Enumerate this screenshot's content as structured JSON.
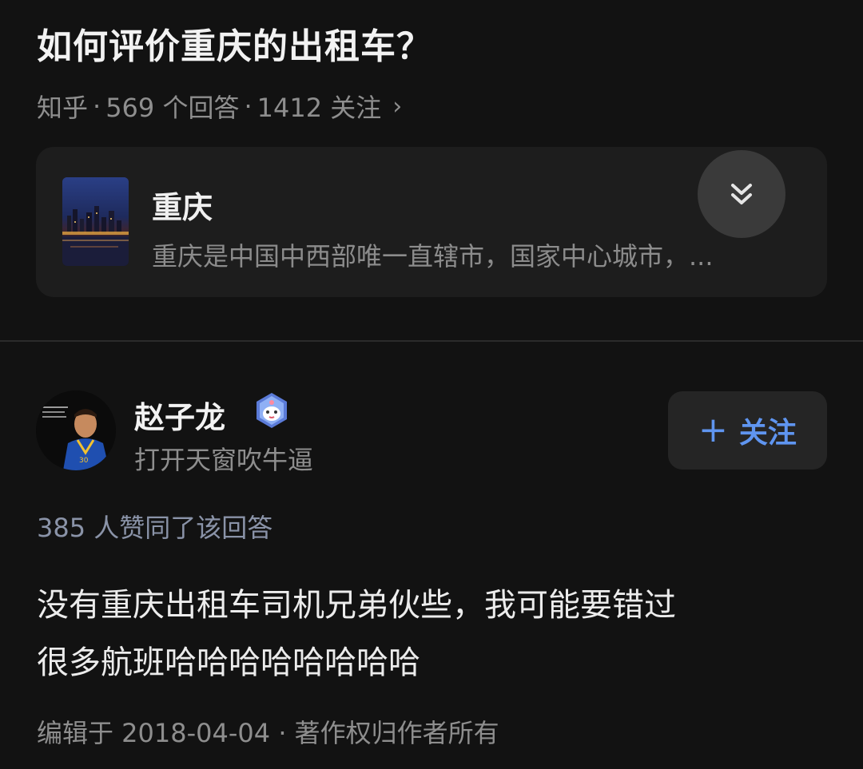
{
  "question": {
    "title": "如何评价重庆的出租车？",
    "source": "知乎",
    "answers": "569 个回答",
    "followers": "1412 关注",
    "separator": "·",
    "chevron": "›"
  },
  "topic": {
    "name": "重庆",
    "description": "重庆是中国中西部唯一直辖市，国家中心城市，...",
    "thumbnail_icon": "city-night-skyline",
    "expand_icon": "double-chevron-down-icon"
  },
  "author": {
    "name": "赵子龙",
    "bio": "打开天窗吹牛逼",
    "badge_icon": "creator-badge-icon",
    "follow_plus": "+",
    "follow_label": "关注"
  },
  "answer": {
    "votes": "385 人赞同了该回答",
    "lines": [
      "没有重庆出租车司机兄弟伙些，我可能要错过",
      "很多航班哈哈哈哈哈哈哈哈"
    ],
    "footer": "编辑于 2018-04-04 · 著作权归作者所有"
  },
  "colors": {
    "background": "#121212",
    "card": "#1d1d1d",
    "accent_blue": "#5f95f0",
    "muted": "#8e8e8e"
  }
}
